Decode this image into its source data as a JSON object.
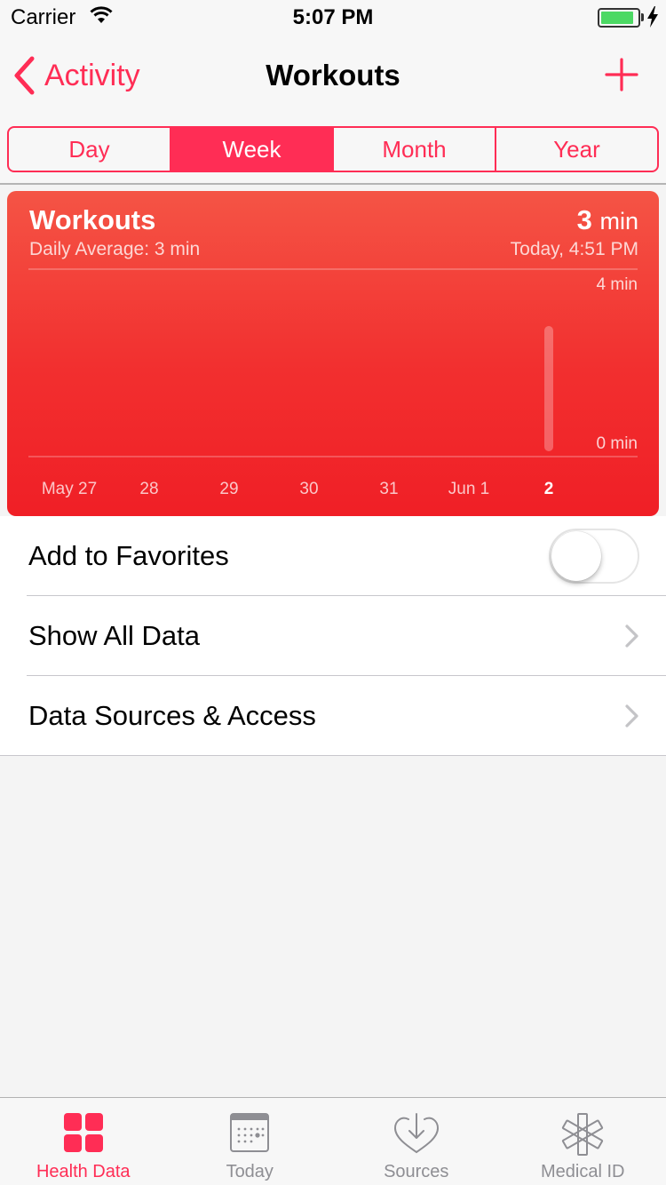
{
  "status_bar": {
    "carrier": "Carrier",
    "time": "5:07 PM",
    "battery_level": 0.9
  },
  "nav": {
    "back_label": "Activity",
    "title": "Workouts",
    "add_icon": "plus-icon",
    "back_icon": "chevron-left-icon"
  },
  "segments": [
    {
      "label": "Day",
      "active": false
    },
    {
      "label": "Week",
      "active": true
    },
    {
      "label": "Month",
      "active": false
    },
    {
      "label": "Year",
      "active": false
    }
  ],
  "card": {
    "title": "Workouts",
    "subtitle": "Daily Average: 3 min",
    "value": "3",
    "unit": "min",
    "timestamp": "Today, 4:51 PM",
    "gradient_colors": [
      "#f45445",
      "#f01f26"
    ]
  },
  "chart_data": {
    "type": "bar",
    "categories": [
      "May 27",
      "28",
      "29",
      "30",
      "31",
      "Jun 1",
      "2"
    ],
    "values": [
      0,
      0,
      0,
      0,
      0,
      0,
      3
    ],
    "ylim": [
      0,
      4
    ],
    "ytick_labels": [
      "4 min",
      "0 min"
    ],
    "highlighted_category": "2",
    "grid": true
  },
  "list": {
    "favorites_label": "Add to Favorites",
    "favorites_on": false,
    "show_all_label": "Show All Data",
    "sources_label": "Data Sources & Access"
  },
  "tabs": [
    {
      "label": "Health Data",
      "icon": "grid-icon",
      "active": true
    },
    {
      "label": "Today",
      "icon": "calendar-icon",
      "active": false
    },
    {
      "label": "Sources",
      "icon": "heart-download-icon",
      "active": false
    },
    {
      "label": "Medical ID",
      "icon": "medical-star-icon",
      "active": false
    }
  ],
  "colors": {
    "accent": "#ff2d55",
    "battery": "#4cd964",
    "tab_inactive": "#8e8e93"
  }
}
